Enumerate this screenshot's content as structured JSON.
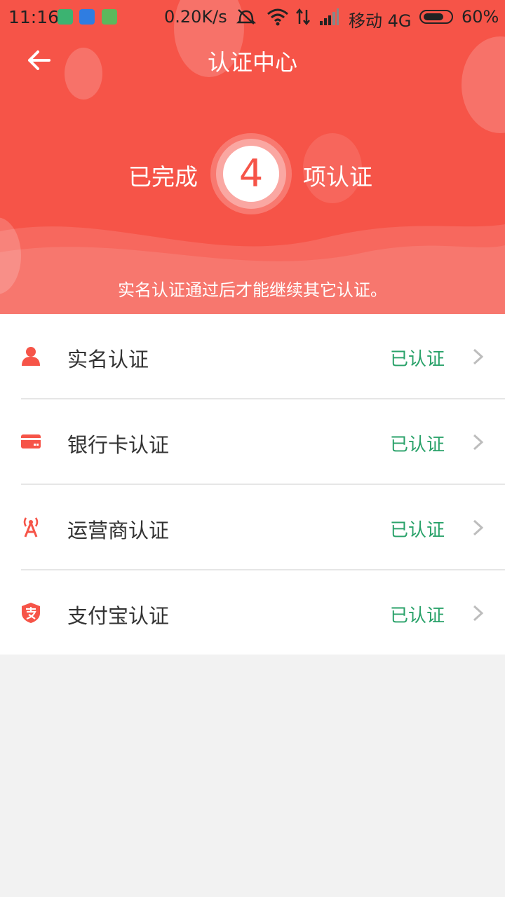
{
  "status_bar": {
    "time": "11:16",
    "net_speed": "0.20K/s",
    "carrier": "移动 4G",
    "battery": "60%",
    "battery_level": 0.6
  },
  "header": {
    "title": "认证中心",
    "done_prefix": "已完成",
    "done_count": "4",
    "done_suffix": "项认证",
    "note": "实名认证通过后才能继续其它认证。"
  },
  "items": [
    {
      "label": "实名认证",
      "status": "已认证",
      "icon": "person-icon"
    },
    {
      "label": "银行卡认证",
      "status": "已认证",
      "icon": "bank-card-icon"
    },
    {
      "label": "运营商认证",
      "status": "已认证",
      "icon": "signal-tower-icon"
    },
    {
      "label": "支付宝认证",
      "status": "已认证",
      "icon": "alipay-icon"
    }
  ],
  "colors": {
    "header_bg": "#f65448",
    "accent": "#f65448",
    "status_green": "#2aa26a"
  }
}
